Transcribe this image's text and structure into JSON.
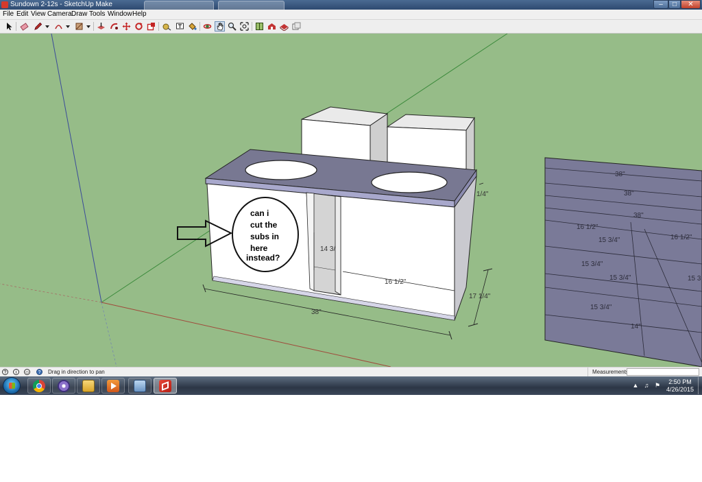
{
  "window": {
    "title": "Sundown 2-12s - SketchUp Make",
    "controls": {
      "minimize": "–",
      "maximize": "□",
      "close": "✕"
    }
  },
  "menu": [
    "File",
    "Edit",
    "View",
    "Camera",
    "Draw",
    "Tools",
    "Window",
    "Help"
  ],
  "toolbar": {
    "tools": [
      {
        "name": "select",
        "icon": "arrow-cursor-icon"
      },
      {
        "name": "eraser",
        "icon": "eraser-icon"
      },
      {
        "name": "pencil",
        "icon": "pencil-icon"
      },
      {
        "name": "arc",
        "icon": "arc-icon"
      },
      {
        "name": "rectangle",
        "icon": "rectangle-icon"
      },
      {
        "name": "push-pull",
        "icon": "push-pull-icon"
      },
      {
        "name": "follow-me",
        "icon": "follow-me-icon"
      },
      {
        "name": "move",
        "icon": "move-icon"
      },
      {
        "name": "rotate",
        "icon": "rotate-icon"
      },
      {
        "name": "scale",
        "icon": "scale-icon"
      },
      {
        "name": "tape-measure",
        "icon": "tape-measure-icon"
      },
      {
        "name": "text",
        "icon": "text-icon"
      },
      {
        "name": "paint-bucket",
        "icon": "paint-bucket-icon"
      },
      {
        "name": "orbit",
        "icon": "orbit-icon"
      },
      {
        "name": "pan",
        "icon": "pan-hand-icon",
        "active": true
      },
      {
        "name": "zoom",
        "icon": "zoom-icon"
      },
      {
        "name": "zoom-extents",
        "icon": "zoom-extents-icon"
      },
      {
        "name": "components",
        "icon": "components-icon"
      },
      {
        "name": "3d-warehouse",
        "icon": "warehouse-icon"
      },
      {
        "name": "extension-warehouse",
        "icon": "extension-icon"
      },
      {
        "name": "send-to-layout",
        "icon": "layout-icon"
      }
    ]
  },
  "model": {
    "annotation": {
      "line1": "can i",
      "line2": "cut the",
      "line3": "subs in",
      "line4": "here",
      "line5": "instead?"
    },
    "dimensions": {
      "width": "38\"",
      "inner_width": "16 1/2\"",
      "height": "17 1/4\"",
      "partial_depth": "14 3/",
      "top_right": "1/4\""
    },
    "cut_sheet": {
      "labels": [
        "38\"",
        "38\"",
        "38\"",
        "16 1/2\"",
        "16 1/2\"",
        "15 3/4\"",
        "15 3/4\"",
        "15 3/4\"",
        "15 3",
        "15 3/4\"",
        "14\""
      ]
    },
    "colors": {
      "ground": "#96bc88",
      "sheet": "#7a7a98",
      "box_face": "#ffffff",
      "top_board": "#777790"
    }
  },
  "status": {
    "hint": "Drag in direction to pan",
    "measurements_label": "Measurements",
    "measurements_value": ""
  },
  "taskbar": {
    "apps": [
      {
        "name": "chrome",
        "icon": "chrome-icon"
      },
      {
        "name": "media-center",
        "icon": "media-center-icon"
      },
      {
        "name": "file-explorer",
        "icon": "folder-icon"
      },
      {
        "name": "media-player",
        "icon": "media-player-icon"
      },
      {
        "name": "windows-explorer",
        "icon": "explorer-window-icon"
      },
      {
        "name": "sketchup",
        "icon": "sketchup-icon",
        "active": true
      }
    ],
    "time": "2:50 PM",
    "date": "4/26/2015"
  }
}
